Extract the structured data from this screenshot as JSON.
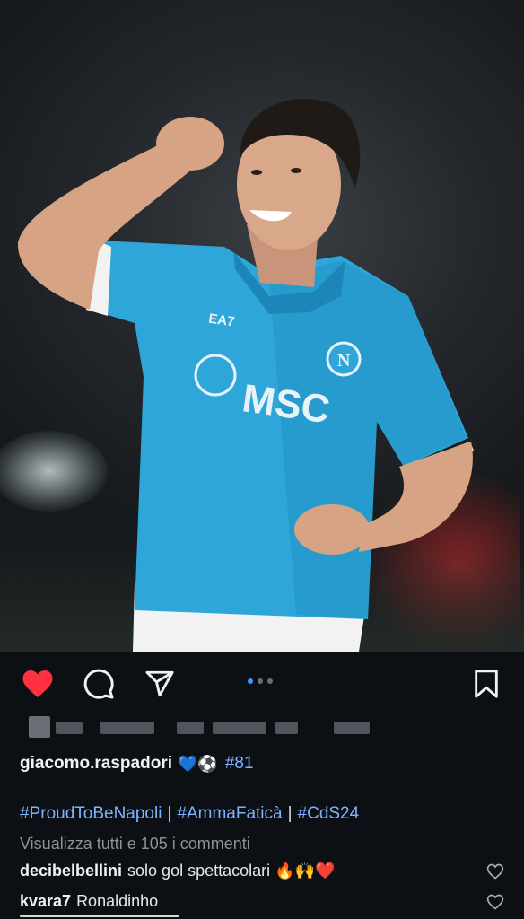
{
  "post": {
    "photo_alt": "Player in light-blue Napoli shirt celebrating with raised fist",
    "carousel": {
      "count": 3,
      "active_index": 0
    },
    "liked": true,
    "author": {
      "username": "giacomo.raspadori",
      "emoji": "💙⚽",
      "tag": "#81"
    },
    "hashtags": [
      "#ProudToBeNapoli",
      "#AmmaFaticà",
      "#CdS24"
    ],
    "hashtag_separator": "|",
    "view_comments": "Visualizza tutti e 105 i commenti",
    "comments": [
      {
        "user": "decibelbellini",
        "text": "solo gol spettacolari 🔥🙌❤️"
      },
      {
        "user": "kvara7",
        "text": "Ronaldinho"
      }
    ]
  },
  "colors": {
    "like_red": "#ff3040",
    "link_blue": "#7fb3ff",
    "active_dot": "#3d9bff",
    "background": "#0c0f14"
  },
  "icons": {
    "like": "heart-icon",
    "comment": "speech-bubble-icon",
    "share": "paper-plane-icon",
    "save": "bookmark-icon",
    "comment_like": "heart-outline-icon"
  }
}
